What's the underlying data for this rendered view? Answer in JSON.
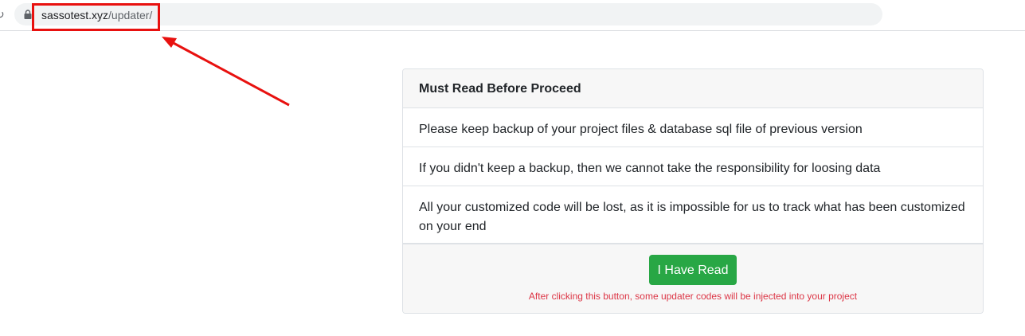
{
  "browser": {
    "url_host": "sassotest.xyz",
    "url_path": "/updater/",
    "lock_icon": "lock-icon",
    "reload_icon": "reload-icon"
  },
  "annotation": {
    "color": "#e8110f"
  },
  "card": {
    "title": "Must Read Before Proceed",
    "items": [
      "Please keep backup of your project files & database sql file of previous version",
      "If you didn't keep a backup, then we cannot take the responsibility for loosing data",
      "All your customized code will be lost, as it is impossible for us to track what has been customized on your end"
    ],
    "button_label": "I Have Read",
    "button_color": "#28a745",
    "note": "After clicking this button, some updater codes will be injected into your project",
    "note_color": "#dc3545"
  }
}
